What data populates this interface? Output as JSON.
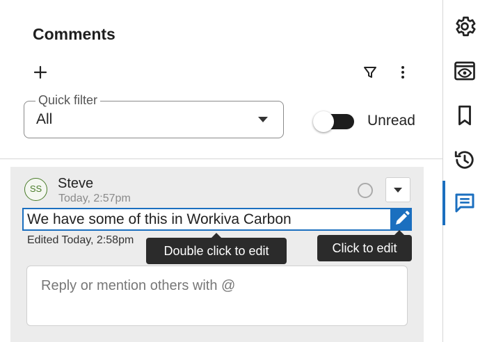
{
  "panel": {
    "title": "Comments",
    "add_icon": "plus-icon",
    "filter_icon": "filter-icon",
    "more_icon": "more-vertical-icon"
  },
  "quick_filter": {
    "label": "Quick filter",
    "value": "All",
    "caret_icon": "caret-down-icon"
  },
  "unread_toggle": {
    "label": "Unread",
    "on": false
  },
  "comment": {
    "avatar_initials": "SS",
    "author": "Steve",
    "timestamp": "Today, 2:57pm",
    "body": "We have some of this in Workiva Carbon",
    "edited": "Edited Today, 2:58pm",
    "resolve_icon": "circle-icon",
    "menu_icon": "caret-down-icon",
    "edit_icon": "pencil-icon"
  },
  "tooltips": {
    "double_click": "Double click to edit",
    "click": "Click to edit"
  },
  "reply": {
    "placeholder": "Reply or mention others with @"
  },
  "rail": {
    "items": [
      {
        "icon": "gear-icon",
        "active": false
      },
      {
        "icon": "eye-icon",
        "active": false
      },
      {
        "icon": "bookmark-icon",
        "active": false
      },
      {
        "icon": "history-icon",
        "active": false
      },
      {
        "icon": "comment-icon",
        "active": true
      }
    ]
  },
  "colors": {
    "accent": "#1b6fbf",
    "avatar": "#4a7c2a",
    "card_bg": "#ececec",
    "tooltip_bg": "#2b2b2b"
  }
}
